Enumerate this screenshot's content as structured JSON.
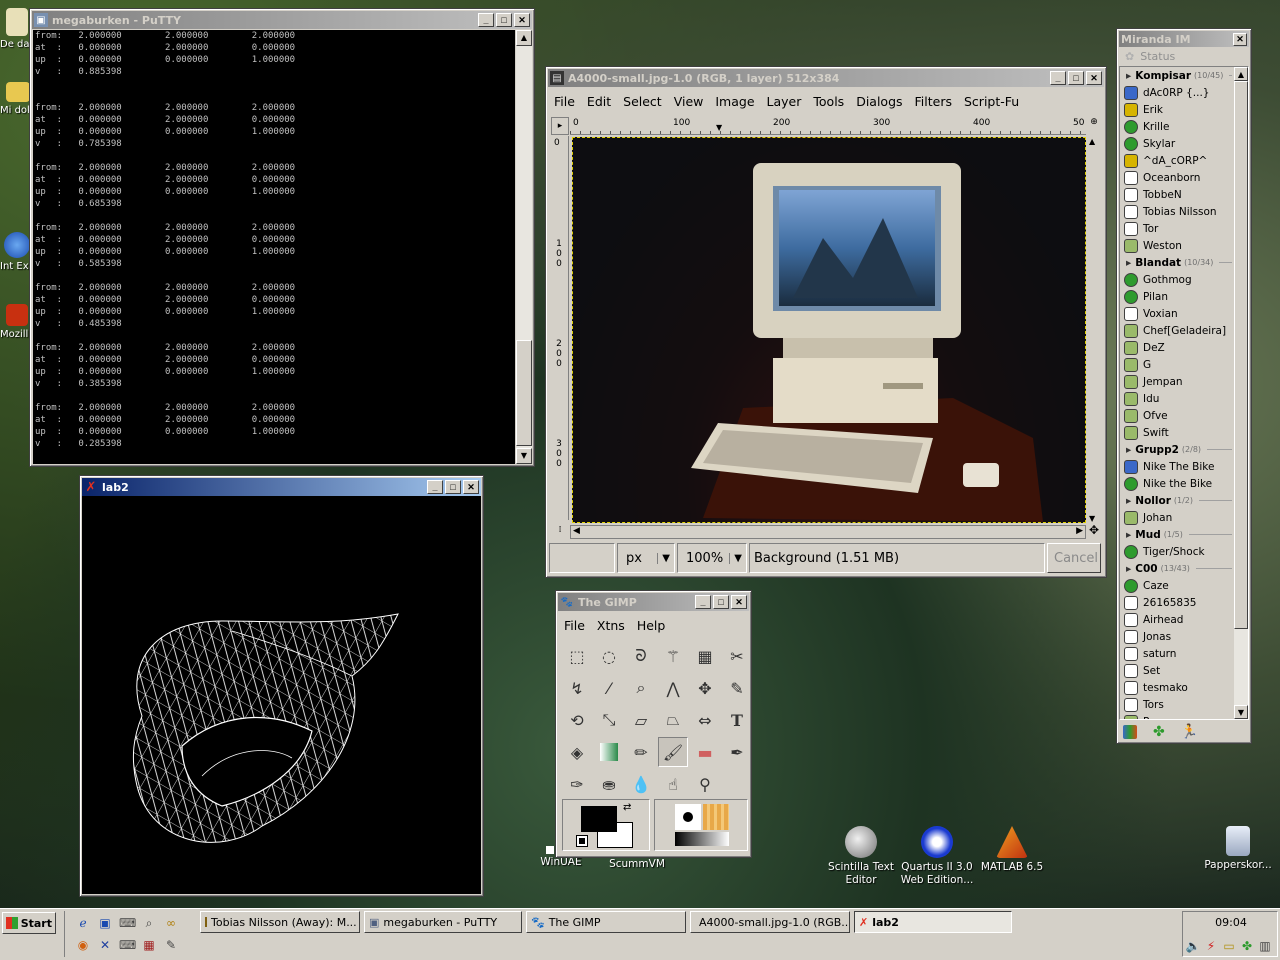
{
  "desktop": {
    "icons_left": [
      {
        "label": "De da",
        "icon": "document-icon"
      },
      {
        "label": "Mi dok",
        "icon": "folder-icon"
      },
      {
        "label": "Int Ex",
        "icon": "ie-icon"
      },
      {
        "label": "Mozill",
        "icon": "mozilla-icon"
      }
    ],
    "icons_bottom": [
      {
        "label": "WinUAE",
        "icon": "winuae-icon"
      },
      {
        "label": "ScummVM",
        "icon": "scummvm-icon"
      },
      {
        "label": "Scintilla Text Editor",
        "icon": "scintilla-icon"
      },
      {
        "label": "Quartus II 3.0 Web Edition...",
        "icon": "quartus-icon"
      },
      {
        "label": "MATLAB 6.5",
        "icon": "matlab-icon"
      },
      {
        "label": "Papperskor...",
        "icon": "recycle-bin-icon"
      }
    ]
  },
  "putty": {
    "title": "megaburken - PuTTY",
    "top_lines": [
      "from:   2.000000        2.000000        2.000000",
      "at  :   0.000000        2.000000        0.000000",
      "up  :   0.000000        0.000000        1.000000",
      "v   :   0.885398"
    ],
    "blocks": [
      {
        "from": "from:   2.000000        2.000000        2.000000",
        "at": "at  :   0.000000        2.000000        0.000000",
        "up": "up  :   0.000000        0.000000        1.000000",
        "v": "v   :   0.785398"
      },
      {
        "from": "from:   2.000000        2.000000        2.000000",
        "at": "at  :   0.000000        2.000000        0.000000",
        "up": "up  :   0.000000        0.000000        1.000000",
        "v": "v   :   0.685398"
      },
      {
        "from": "from:   2.000000        2.000000        2.000000",
        "at": "at  :   0.000000        2.000000        0.000000",
        "up": "up  :   0.000000        0.000000        1.000000",
        "v": "v   :   0.585398"
      },
      {
        "from": "from:   2.000000        2.000000        2.000000",
        "at": "at  :   0.000000        2.000000        0.000000",
        "up": "up  :   0.000000        0.000000        1.000000",
        "v": "v   :   0.485398"
      },
      {
        "from": "from:   2.000000        2.000000        2.000000",
        "at": "at  :   0.000000        2.000000        0.000000",
        "up": "up  :   0.000000        0.000000        1.000000",
        "v": "v   :   0.385398"
      },
      {
        "from": "from:   2.000000        2.000000        2.000000",
        "at": "at  :   0.000000        2.000000        0.000000",
        "up": "up  :   0.000000        0.000000        1.000000",
        "v": "v   :   0.285398"
      }
    ]
  },
  "lab2": {
    "title": "lab2"
  },
  "gimp_image": {
    "title": "A4000-small.jpg-1.0 (RGB, 1 layer) 512x384",
    "menu": [
      "File",
      "Edit",
      "Select",
      "View",
      "Image",
      "Layer",
      "Tools",
      "Dialogs",
      "Filters",
      "Script-Fu"
    ],
    "ruler_top": [
      "0",
      "100",
      "200",
      "300",
      "400",
      "50"
    ],
    "ruler_left": [
      "0",
      "100",
      "200",
      "300"
    ],
    "unit": "px",
    "zoom": "100%",
    "status": "Background (1.51 MB)",
    "cancel": "Cancel"
  },
  "gimp_toolbox": {
    "title": "The GIMP",
    "menu": [
      "File",
      "Xtns",
      "Help"
    ],
    "tools": [
      "rect-select-icon",
      "ellipse-select-icon",
      "lasso-icon",
      "fuzzy-select-icon",
      "color-select-icon",
      "scissors-icon",
      "paths-icon",
      "color-picker-icon",
      "zoom-icon",
      "measure-icon",
      "move-icon",
      "crop-icon",
      "rotate-icon",
      "scale-icon",
      "shear-icon",
      "perspective-icon",
      "flip-icon",
      "text-icon",
      "bucket-fill-icon",
      "blend-icon",
      "pencil-icon",
      "paintbrush-icon",
      "eraser-icon",
      "airbrush-icon",
      "ink-icon",
      "clone-icon",
      "convolve-icon",
      "smudge-icon",
      "dodge-burn-icon"
    ],
    "fg_color": "#000000",
    "bg_color": "#ffffff"
  },
  "miranda": {
    "title": "Miranda IM",
    "status": "Status",
    "items": [
      {
        "type": "group",
        "name": "Kompisar",
        "count": "(10/45)"
      },
      {
        "type": "contact",
        "name": "dAc0RP {...}",
        "status": "multi"
      },
      {
        "type": "contact",
        "name": "Erik",
        "status": "away"
      },
      {
        "type": "contact",
        "name": "Krille",
        "status": "online"
      },
      {
        "type": "contact",
        "name": "Skylar",
        "status": "online"
      },
      {
        "type": "contact",
        "name": "^dA_cORP^",
        "status": "away"
      },
      {
        "type": "contact",
        "name": "Oceanborn",
        "status": "msn"
      },
      {
        "type": "contact",
        "name": "TobbeN",
        "status": "msn"
      },
      {
        "type": "contact",
        "name": "Tobias Nilsson",
        "status": "msn"
      },
      {
        "type": "contact",
        "name": "Tor",
        "status": "msn"
      },
      {
        "type": "contact",
        "name": "Weston",
        "status": "icq"
      },
      {
        "type": "group",
        "name": "Blandat",
        "count": "(10/34)"
      },
      {
        "type": "contact",
        "name": "Gothmog",
        "status": "online"
      },
      {
        "type": "contact",
        "name": "Pilan",
        "status": "online"
      },
      {
        "type": "contact",
        "name": "Voxian",
        "status": "msn"
      },
      {
        "type": "contact",
        "name": "Chef[Geladeira]",
        "status": "icq"
      },
      {
        "type": "contact",
        "name": "DeZ",
        "status": "icq"
      },
      {
        "type": "contact",
        "name": "G",
        "status": "icq"
      },
      {
        "type": "contact",
        "name": "Jempan",
        "status": "icq"
      },
      {
        "type": "contact",
        "name": "Idu",
        "status": "icq"
      },
      {
        "type": "contact",
        "name": "Ofve",
        "status": "icq"
      },
      {
        "type": "contact",
        "name": "Swift",
        "status": "icq"
      },
      {
        "type": "group",
        "name": "Grupp2",
        "count": "(2/8)"
      },
      {
        "type": "contact",
        "name": "Nike The Bike",
        "status": "multi"
      },
      {
        "type": "contact",
        "name": "Nike the Bike",
        "status": "online"
      },
      {
        "type": "group",
        "name": "Nollor",
        "count": "(1/2)"
      },
      {
        "type": "contact",
        "name": "Johan",
        "status": "icq"
      },
      {
        "type": "group",
        "name": "Mud",
        "count": "(1/5)"
      },
      {
        "type": "contact",
        "name": "Tiger/Shock",
        "status": "online"
      },
      {
        "type": "group",
        "name": "C00",
        "count": "(13/43)"
      },
      {
        "type": "contact",
        "name": "Caze",
        "status": "online"
      },
      {
        "type": "contact",
        "name": "26165835",
        "status": "msn"
      },
      {
        "type": "contact",
        "name": "Airhead",
        "status": "msn"
      },
      {
        "type": "contact",
        "name": "Jonas",
        "status": "msn"
      },
      {
        "type": "contact",
        "name": "saturn",
        "status": "msn"
      },
      {
        "type": "contact",
        "name": "Set",
        "status": "msn"
      },
      {
        "type": "contact",
        "name": "tesmako",
        "status": "msn"
      },
      {
        "type": "contact",
        "name": "Tors",
        "status": "msn"
      },
      {
        "type": "contact",
        "name": "Perre",
        "status": "icq"
      }
    ],
    "status_colors": {
      "online": "#2e9b2e",
      "away": "#d6b400",
      "msn": "#ffffff",
      "icq": "#9aba6a",
      "multi": "#3a68c8"
    }
  },
  "taskbar": {
    "start": "Start",
    "tasks": [
      {
        "label": "Tobias Nilsson (Away): M...",
        "icon": "msn-icon"
      },
      {
        "label": "megaburken - PuTTY",
        "icon": "putty-icon"
      },
      {
        "label": "The GIMP",
        "icon": "gimp-icon"
      },
      {
        "label": "A4000-small.jpg-1.0 (RGB...",
        "icon": "gimp-image-icon"
      },
      {
        "label": "lab2",
        "icon": "x11-icon"
      }
    ],
    "clock": "09:04"
  }
}
